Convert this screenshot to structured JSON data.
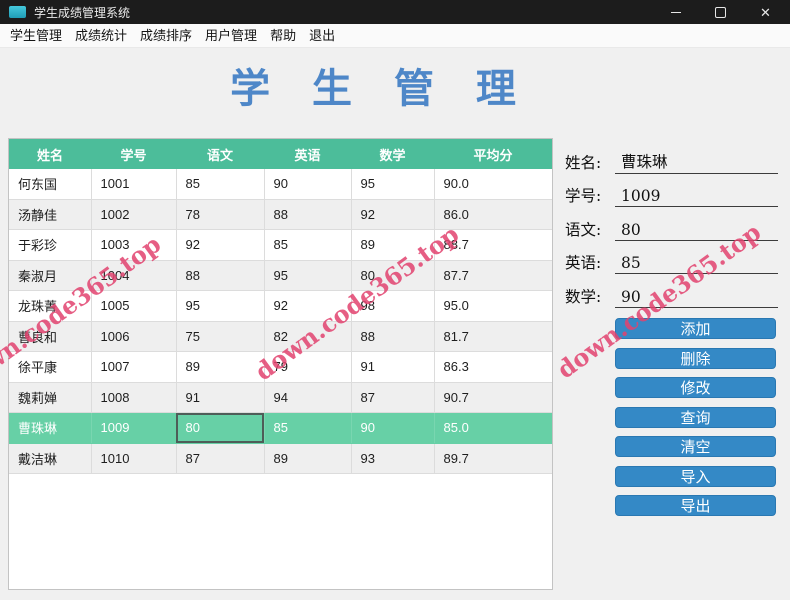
{
  "window": {
    "title": "学生成绩管理系统"
  },
  "menu": {
    "items": [
      {
        "label": "学生管理",
        "name": "student-manage"
      },
      {
        "label": "成绩统计",
        "name": "score-stats"
      },
      {
        "label": "成绩排序",
        "name": "score-sort"
      },
      {
        "label": "用户管理",
        "name": "user-manage"
      },
      {
        "label": "帮助",
        "name": "help"
      },
      {
        "label": "退出",
        "name": "exit"
      }
    ]
  },
  "page": {
    "title": "学 生 管 理"
  },
  "table": {
    "headers": [
      "姓名",
      "学号",
      "语文",
      "英语",
      "数学",
      "平均分"
    ],
    "rows": [
      [
        "何东国",
        "1001",
        "85",
        "90",
        "95",
        "90.0"
      ],
      [
        "汤静佳",
        "1002",
        "78",
        "88",
        "92",
        "86.0"
      ],
      [
        "于彩珍",
        "1003",
        "92",
        "85",
        "89",
        "88.7"
      ],
      [
        "秦淑月",
        "1004",
        "88",
        "95",
        "80",
        "87.7"
      ],
      [
        "龙珠菁",
        "1005",
        "95",
        "92",
        "98",
        "95.0"
      ],
      [
        "曹良和",
        "1006",
        "75",
        "82",
        "88",
        "81.7"
      ],
      [
        "徐平康",
        "1007",
        "89",
        "79",
        "91",
        "86.3"
      ],
      [
        "魏莉婵",
        "1008",
        "91",
        "94",
        "87",
        "90.7"
      ],
      [
        "曹珠琳",
        "1009",
        "80",
        "85",
        "90",
        "85.0"
      ],
      [
        "戴洁琳",
        "1010",
        "87",
        "89",
        "93",
        "89.7"
      ]
    ],
    "selected_row": 8,
    "focused_cell": {
      "row": 8,
      "col": 2
    }
  },
  "form": {
    "fields": [
      {
        "label": "姓名:",
        "value": "曹珠琳",
        "name": "name"
      },
      {
        "label": "学号:",
        "value": "1009",
        "name": "student-id"
      },
      {
        "label": "语文:",
        "value": "80",
        "name": "chinese"
      },
      {
        "label": "英语:",
        "value": "85",
        "name": "english"
      },
      {
        "label": "数学:",
        "value": "90",
        "name": "math"
      }
    ]
  },
  "actions": [
    {
      "label": "添加",
      "name": "add"
    },
    {
      "label": "删除",
      "name": "delete"
    },
    {
      "label": "修改",
      "name": "modify"
    },
    {
      "label": "查询",
      "name": "query"
    },
    {
      "label": "清空",
      "name": "clear"
    },
    {
      "label": "导入",
      "name": "import"
    },
    {
      "label": "导出",
      "name": "export"
    }
  ],
  "watermark": {
    "text": "down.code365.top",
    "color": "#e2436f"
  },
  "colors": {
    "titlebar": "#1c1c1c",
    "table_header_teal": "#4cbd9a",
    "selected_row_teal": "#67d0a6",
    "button_blue": "#3489c6",
    "title_blue": "#4e87c8"
  }
}
